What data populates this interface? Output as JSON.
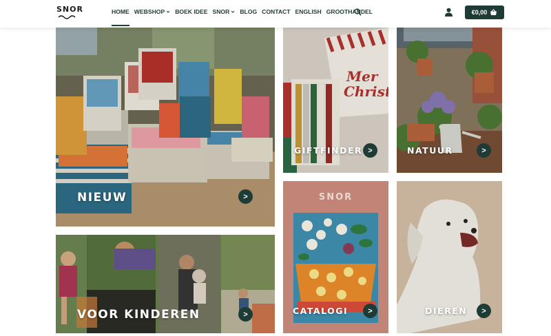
{
  "logo": {
    "text": "SNOR"
  },
  "nav": {
    "items": [
      {
        "label": "HOME",
        "active": true,
        "dropdown": false
      },
      {
        "label": "WEBSHOP",
        "active": false,
        "dropdown": true
      },
      {
        "label": "BOEK IDEE",
        "active": false,
        "dropdown": false
      },
      {
        "label": "SNOR",
        "active": false,
        "dropdown": true
      },
      {
        "label": "BLOG",
        "active": false,
        "dropdown": false
      },
      {
        "label": "CONTACT",
        "active": false,
        "dropdown": false
      },
      {
        "label": "ENGLISH",
        "active": false,
        "dropdown": false
      },
      {
        "label": "GROOTHANDEL",
        "active": false,
        "dropdown": false
      }
    ],
    "search_icon": "search-icon",
    "account_icon": "user-icon"
  },
  "cart": {
    "total": "€0,00",
    "icon": "basket-icon"
  },
  "tiles": {
    "nieuw": {
      "label": "NIEUW",
      "arrow": ">"
    },
    "giftfinder": {
      "label": "GIFTFINDER",
      "arrow": ">"
    },
    "natuur": {
      "label": "NATUUR",
      "arrow": ">"
    },
    "kinderen": {
      "label": "VOOR KINDEREN",
      "arrow": ">"
    },
    "catalogi": {
      "label": "CATALOGI",
      "arrow": ">",
      "cover_title": "SNOR"
    },
    "dieren": {
      "label": "DIEREN",
      "arrow": ">"
    }
  },
  "colors": {
    "brand": "#1f3b35",
    "catalog_bg": "#c98a7c",
    "dog_bg": "#d2bca4"
  }
}
